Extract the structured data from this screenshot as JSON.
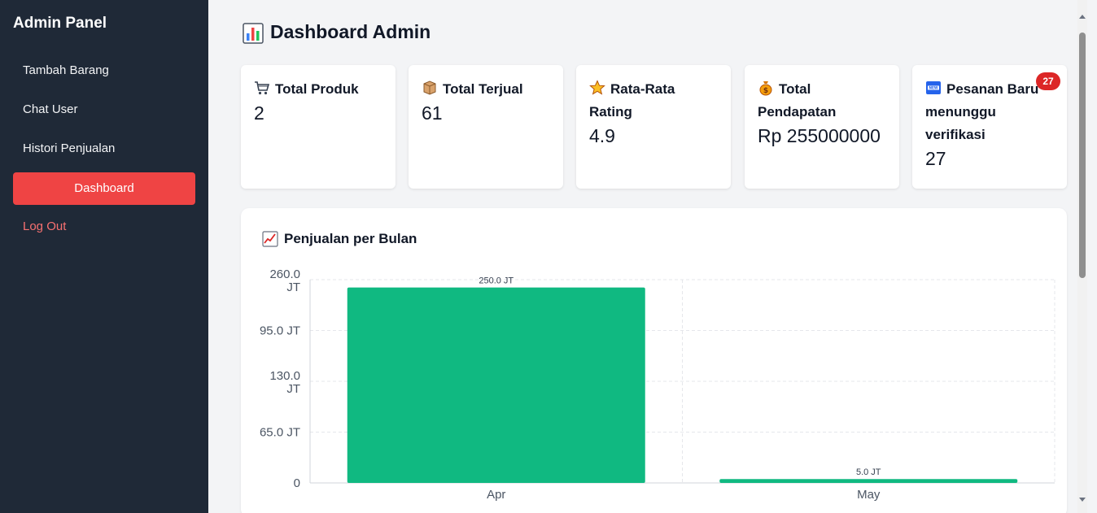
{
  "sidebar": {
    "brand": "Admin Panel",
    "items": [
      {
        "label": "Tambah Barang"
      },
      {
        "label": "Chat User"
      },
      {
        "label": "Histori Penjualan"
      },
      {
        "label": "Dashboard"
      },
      {
        "label": "Log Out"
      }
    ]
  },
  "header": {
    "title": "Dashboard Admin",
    "icon": "bar-chart-icon"
  },
  "cards": [
    {
      "title": "Total Produk",
      "value": "2",
      "icon": "cart-icon"
    },
    {
      "title": "Total Terjual",
      "value": "61",
      "icon": "box-icon"
    },
    {
      "title": "Rata-Rata Rating",
      "value": "4.9",
      "icon": "star-icon"
    },
    {
      "title": "Total Pendapatan",
      "value": "Rp 255000000",
      "icon": "money-bag-icon"
    },
    {
      "title": "Pesanan Baru menunggu verifikasi",
      "value": "27",
      "badge": "27",
      "icon": "new-icon"
    }
  ],
  "colors": {
    "sidebar_bg": "#1f2937",
    "accent": "#ef4444",
    "bar": "#10b981",
    "badge": "#dc2626"
  },
  "chart_data": {
    "type": "bar",
    "title": "Penjualan per Bulan",
    "categories": [
      "Apr",
      "May"
    ],
    "values": [
      250000000,
      5000000
    ],
    "value_labels": [
      "250.0 JT",
      "5.0 JT"
    ],
    "ytick_labels": [
      "260.0 JT",
      "95.0 JT",
      "130.0 JT",
      "65.0 JT",
      "0"
    ],
    "ylim": [
      0,
      260000000
    ],
    "grid": true
  }
}
